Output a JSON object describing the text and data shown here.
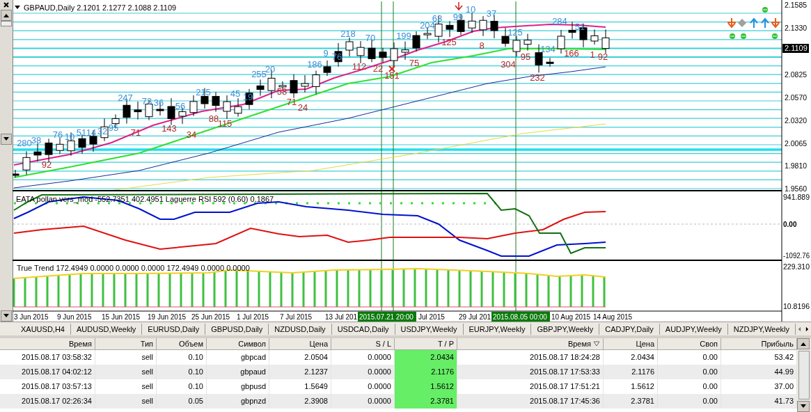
{
  "chart": {
    "header": "GBPAUD,Daily  2.1201 2.1277 2.1088 2.1109",
    "price_axis": [
      "2.1585",
      "2.1330",
      "2.0825",
      "2.0570",
      "2.0320",
      "2.0065",
      "1.9810",
      "1.9560"
    ],
    "current_price": "2.1109",
    "bar_labels": [
      {
        "text": "280",
        "kind": "up"
      },
      {
        "text": "38",
        "kind": "up"
      },
      {
        "text": "76",
        "kind": "up"
      },
      {
        "text": "10",
        "kind": "up"
      },
      {
        "text": "51",
        "kind": "up"
      },
      {
        "text": "14",
        "kind": "up"
      },
      {
        "text": "32",
        "kind": "up"
      },
      {
        "text": "95",
        "kind": "up"
      },
      {
        "text": "247",
        "kind": "up"
      },
      {
        "text": "73",
        "kind": "up"
      },
      {
        "text": "36",
        "kind": "up"
      },
      {
        "text": "56",
        "kind": "up"
      },
      {
        "text": "215",
        "kind": "up"
      },
      {
        "text": "45",
        "kind": "up"
      },
      {
        "text": "19",
        "kind": "up"
      },
      {
        "text": "255",
        "kind": "up"
      },
      {
        "text": "20",
        "kind": "up"
      },
      {
        "text": "186",
        "kind": "up"
      },
      {
        "text": "9",
        "kind": "up"
      },
      {
        "text": "76",
        "kind": "up"
      },
      {
        "text": "218",
        "kind": "up"
      },
      {
        "text": "70",
        "kind": "up"
      },
      {
        "text": "199",
        "kind": "up"
      },
      {
        "text": "204",
        "kind": "up"
      },
      {
        "text": "63",
        "kind": "up"
      },
      {
        "text": "99",
        "kind": "up"
      },
      {
        "text": "10",
        "kind": "up"
      },
      {
        "text": "37",
        "kind": "up"
      },
      {
        "text": "125",
        "kind": "up"
      },
      {
        "text": "134",
        "kind": "up"
      },
      {
        "text": "284",
        "kind": "up"
      },
      {
        "text": "51",
        "kind": "up"
      },
      {
        "text": "92",
        "kind": "down"
      },
      {
        "text": "71",
        "kind": "down"
      },
      {
        "text": "143",
        "kind": "down"
      },
      {
        "text": "34",
        "kind": "down"
      },
      {
        "text": "88",
        "kind": "down"
      },
      {
        "text": "115",
        "kind": "down"
      },
      {
        "text": "58",
        "kind": "down"
      },
      {
        "text": "71",
        "kind": "down"
      },
      {
        "text": "24",
        "kind": "down"
      },
      {
        "text": "112",
        "kind": "down"
      },
      {
        "text": "22",
        "kind": "down"
      },
      {
        "text": "151",
        "kind": "down"
      },
      {
        "text": "75",
        "kind": "down"
      },
      {
        "text": "125",
        "kind": "down"
      },
      {
        "text": "8",
        "kind": "down"
      },
      {
        "text": "304",
        "kind": "down"
      },
      {
        "text": "95",
        "kind": "down"
      },
      {
        "text": "232",
        "kind": "down"
      },
      {
        "text": "166",
        "kind": "down"
      },
      {
        "text": "1",
        "kind": "down"
      },
      {
        "text": "92",
        "kind": "down"
      }
    ],
    "indicator_1": {
      "legend": "EATA pollan vers_mod -552.7351 402.4951  Laguerre RSI 592 (0.60) 0.1867",
      "axis": [
        "941.889",
        "0.00",
        "-1092.76"
      ]
    },
    "indicator_2": {
      "legend": "True Trend 172.4949 0.0000 0.0000 0.0000 172.4949 0.0000 0.0000",
      "axis": [
        "229.310",
        "10.8196"
      ]
    },
    "time_axis": [
      {
        "text": "3 Jun 2015",
        "kind": "date"
      },
      {
        "text": "9 Jun 2015",
        "kind": "date"
      },
      {
        "text": "15 Jun 2015",
        "kind": "date"
      },
      {
        "text": "19 Jun 2015",
        "kind": "date"
      },
      {
        "text": "25 Jun 2015",
        "kind": "date"
      },
      {
        "text": "1 Jul 2015",
        "kind": "date"
      },
      {
        "text": "7 Jul 2015",
        "kind": "date"
      },
      {
        "text": "13 Jul 201",
        "kind": "date"
      },
      {
        "text": "2015.07.21 20:00",
        "kind": "cursor"
      },
      {
        "text": "Jul 2015",
        "kind": "date"
      },
      {
        "text": "29 Jul 201",
        "kind": "date"
      },
      {
        "text": "2015.08.05 00:00",
        "kind": "cursor"
      },
      {
        "text": "10 Aug 2015",
        "kind": "date"
      },
      {
        "text": "14 Aug 2015",
        "kind": "date"
      }
    ]
  },
  "tabs": [
    "XAUUSD,H4",
    "AUDUSD,Weekly",
    "EURUSD,Daily",
    "GBPUSD,Daily",
    "NZDUSD,Daily",
    "USDCAD,Daily",
    "USDJPY,Weekly",
    "EURJPY,Weekly",
    "GBPJPY,Weekly",
    "CADJPY,Daily",
    "AUDJPY,Weekly",
    "NZDJPY,Weekly"
  ],
  "table": {
    "columns": [
      {
        "label": "Время",
        "sorted": false
      },
      {
        "label": "Тип",
        "sorted": false
      },
      {
        "label": "Объем",
        "sorted": false
      },
      {
        "label": "Символ",
        "sorted": false
      },
      {
        "label": "Цена",
        "sorted": false
      },
      {
        "label": "S / L",
        "sorted": false
      },
      {
        "label": "T / P",
        "sorted": false
      },
      {
        "label": "Время",
        "sorted": true
      },
      {
        "label": "Цена",
        "sorted": false
      },
      {
        "label": "Своп",
        "sorted": false
      },
      {
        "label": "Прибыль",
        "sorted": false
      }
    ],
    "rows": [
      [
        "2015.08.17 03:58:32",
        "sell",
        "0.10",
        "gbpcad",
        "2.0504",
        "0.0000",
        "2.0434",
        "2015.08.17 18:24:28",
        "2.0434",
        "0.00",
        "53.42"
      ],
      [
        "2015.08.17 04:02:12",
        "sell",
        "0.10",
        "gbpaud",
        "2.1237",
        "0.0000",
        "2.1176",
        "2015.08.17 17:53:33",
        "2.1176",
        "0.00",
        "44.99"
      ],
      [
        "2015.08.17 03:57:13",
        "sell",
        "0.10",
        "gbpusd",
        "1.5649",
        "0.0000",
        "1.5612",
        "2015.08.17 17:51:21",
        "1.5612",
        "0.00",
        "37.00"
      ],
      [
        "2015.08.17 02:26:34",
        "sell",
        "0.05",
        "gbpnzd",
        "2.3908",
        "0.0000",
        "2.3781",
        "2015.08.17 17:45:36",
        "2.3781",
        "0.00",
        "41.73"
      ]
    ]
  }
}
